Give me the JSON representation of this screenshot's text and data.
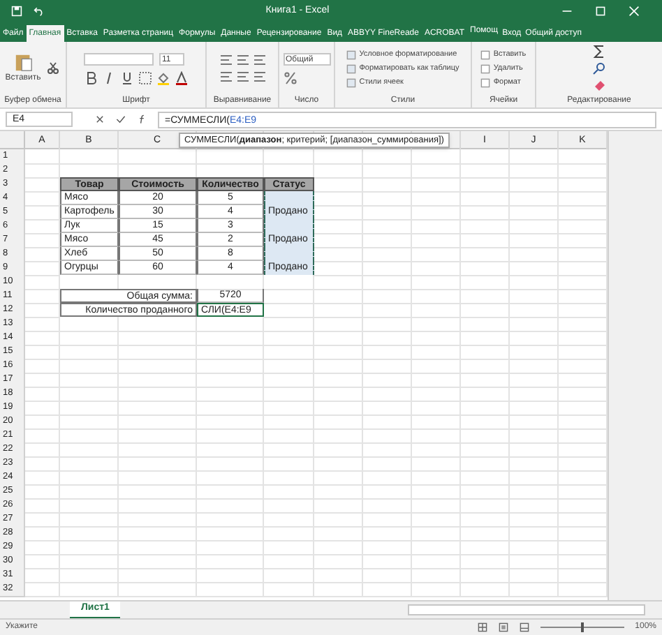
{
  "window": {
    "title": "Книга1 - Excel"
  },
  "ribbon_tabs": [
    {
      "label": "Файл",
      "selected": false
    },
    {
      "label": "Главная",
      "selected": true
    },
    {
      "label": "Вставка",
      "selected": false
    },
    {
      "label": "Разметка страниц",
      "selected": false
    },
    {
      "label": "Формулы",
      "selected": false
    },
    {
      "label": "Данные",
      "selected": false
    },
    {
      "label": "Рецензирование",
      "selected": false
    },
    {
      "label": "Вид",
      "selected": false
    },
    {
      "label": "ABBYY FineReade",
      "selected": false
    },
    {
      "label": "ACROBAT",
      "selected": false
    }
  ],
  "help": "Помощ",
  "sign_in": "Вход",
  "share": "Общий доступ",
  "ribbon": {
    "paste": "Вставить",
    "font_size": "11",
    "number_format": "Общий",
    "styles": [
      "Условное форматирование",
      "Форматировать как таблицу",
      "Стили ячеек"
    ],
    "cells": [
      "Вставить",
      "Удалить",
      "Формат"
    ],
    "groups": [
      "Буфер обмена",
      "Шрифт",
      "Выравнивание",
      "Число",
      "Стили",
      "Ячейки",
      "Редактирование"
    ]
  },
  "formula_bar": {
    "name_box": "E4",
    "formula_prefix": "=СУММЕСЛИ(",
    "formula_ref": "E4:E9",
    "tooltip": "СУММЕСЛИ(**диапазон**; критерий; [диапазон_суммирования])"
  },
  "sheet": {
    "columns": [
      "A",
      "B",
      "C",
      null,
      null,
      null,
      null,
      null,
      "I",
      "J",
      "K"
    ],
    "rows": [
      {
        "number": "1",
        "cells": []
      },
      {
        "number": "2",
        "cells": []
      },
      {
        "number": "3",
        "cells": [
          {
            "kind": "empty"
          },
          {
            "kind": "header",
            "text": "Товар"
          },
          {
            "kind": "header",
            "text": "Стоимость"
          },
          {
            "kind": "header",
            "text": "Количество"
          },
          {
            "kind": "header",
            "text": "Статус"
          }
        ]
      },
      {
        "number": "4",
        "cells": [
          {
            "kind": "empty"
          },
          {
            "kind": "text",
            "text": "Мясо"
          },
          {
            "kind": "number",
            "text": "20"
          },
          {
            "kind": "number",
            "text": "5"
          },
          {
            "kind": "status"
          }
        ]
      },
      {
        "number": "5",
        "cells": [
          {
            "kind": "empty"
          },
          {
            "kind": "text",
            "text": "Картофель"
          },
          {
            "kind": "number",
            "text": "30"
          },
          {
            "kind": "number",
            "text": "4"
          },
          {
            "kind": "status",
            "text": "Продано"
          }
        ]
      },
      {
        "number": "6",
        "cells": [
          {
            "kind": "empty"
          },
          {
            "kind": "text",
            "text": "Лук"
          },
          {
            "kind": "number",
            "text": "15"
          },
          {
            "kind": "number",
            "text": "3"
          },
          {
            "kind": "status"
          }
        ]
      },
      {
        "number": "7",
        "cells": [
          {
            "kind": "empty"
          },
          {
            "kind": "text",
            "text": "Мясо"
          },
          {
            "kind": "number",
            "text": "45"
          },
          {
            "kind": "number",
            "text": "2"
          },
          {
            "kind": "status",
            "text": "Продано"
          }
        ]
      },
      {
        "number": "8",
        "cells": [
          {
            "kind": "empty"
          },
          {
            "kind": "text",
            "text": "Хлеб"
          },
          {
            "kind": "number",
            "text": "50"
          },
          {
            "kind": "number",
            "text": "8"
          },
          {
            "kind": "status"
          }
        ]
      },
      {
        "number": "9",
        "cells": [
          {
            "kind": "empty"
          },
          {
            "kind": "text",
            "text": "Огурцы"
          },
          {
            "kind": "number",
            "text": "60"
          },
          {
            "kind": "number",
            "text": "4"
          },
          {
            "kind": "status",
            "text": "Продано"
          }
        ]
      },
      {
        "number": "10",
        "cells": []
      },
      {
        "number": "11",
        "cells": [
          {
            "kind": "empty"
          },
          {
            "kind": "label",
            "text": "Общая сумма:"
          },
          {
            "kind": "number",
            "text": "5720"
          }
        ]
      },
      {
        "number": "12",
        "cells": [
          {
            "kind": "empty"
          },
          {
            "kind": "label",
            "text": "Количество проданного"
          },
          {
            "kind": "editing",
            "text": "СЛИ(E4:E9"
          }
        ]
      },
      {
        "number": "13",
        "cells": []
      },
      {
        "number": "14",
        "cells": []
      },
      {
        "number": "15",
        "cells": []
      },
      {
        "number": "16",
        "cells": []
      },
      {
        "number": "17",
        "cells": []
      },
      {
        "number": "18",
        "cells": []
      },
      {
        "number": "19",
        "cells": []
      },
      {
        "number": "20",
        "cells": []
      },
      {
        "number": "21",
        "cells": []
      },
      {
        "number": "22",
        "cells": []
      },
      {
        "number": "23",
        "cells": []
      },
      {
        "number": "24",
        "cells": []
      },
      {
        "number": "25",
        "cells": []
      },
      {
        "number": "26",
        "cells": []
      },
      {
        "number": "27",
        "cells": []
      },
      {
        "number": "28",
        "cells": []
      },
      {
        "number": "29",
        "cells": []
      },
      {
        "number": "30",
        "cells": []
      },
      {
        "number": "31",
        "cells": []
      },
      {
        "number": "32",
        "cells": []
      }
    ]
  },
  "sheet_tabs": [
    {
      "label": "Лист1",
      "selected": true
    }
  ],
  "status_bar": {
    "mode": "Укажите",
    "zoom": "100%",
    "zoom_slider": {
      "level": 0.5
    }
  }
}
